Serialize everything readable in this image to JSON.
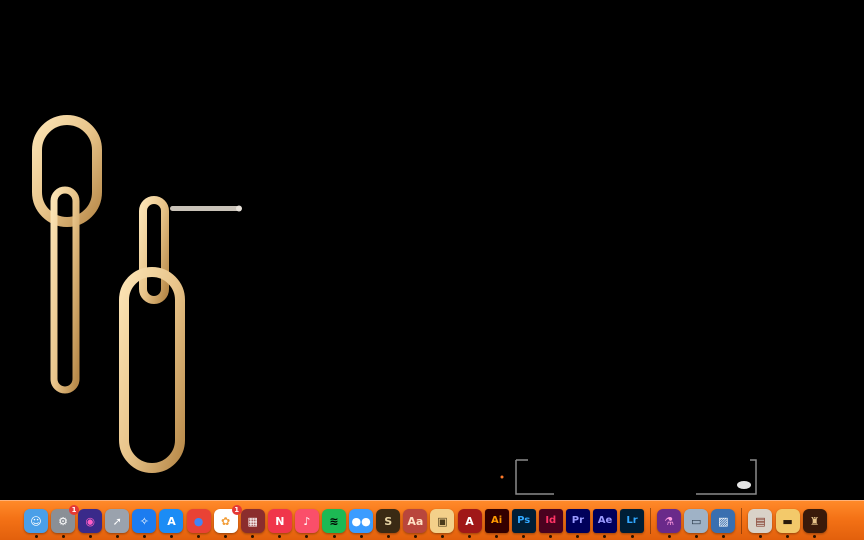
{
  "screen": {
    "background": "#000000"
  },
  "artwork": {
    "subject": "gold-chain-link-earrings",
    "metal_color": "#e8c48a"
  },
  "dock": {
    "background": "#f47216",
    "apps": [
      {
        "name": "Finder",
        "icon": "finder-icon",
        "glyph": "☺",
        "bg": "#4a9fe8",
        "fg": "#ffffff"
      },
      {
        "name": "System Preferences",
        "icon": "gear-icon",
        "glyph": "⚙",
        "bg": "#8a8f96",
        "fg": "#ffffff",
        "badge": "1"
      },
      {
        "name": "Siri",
        "icon": "siri-icon",
        "glyph": "◉",
        "bg": "#3a2a8a",
        "fg": "#ff5ec8"
      },
      {
        "name": "Launchpad",
        "icon": "rocket-icon",
        "glyph": "➚",
        "bg": "#9aa2ad",
        "fg": "#ffffff"
      },
      {
        "name": "Safari",
        "icon": "compass-icon",
        "glyph": "✧",
        "bg": "#1c7cf0",
        "fg": "#ffffff"
      },
      {
        "name": "App Store",
        "icon": "app-store-icon",
        "glyph": "A",
        "bg": "#1b8cf5",
        "fg": "#ffffff"
      },
      {
        "name": "Chrome",
        "icon": "chrome-icon",
        "glyph": "●",
        "bg": "#e94235",
        "fg": "#4285f4"
      },
      {
        "name": "Photos",
        "icon": "photos-icon",
        "glyph": "✿",
        "bg": "#ffffff",
        "fg": "#f29d38",
        "badge": "1"
      },
      {
        "name": "Photo Booth",
        "icon": "photo-booth-icon",
        "glyph": "▦",
        "bg": "#8b2d2d",
        "fg": "#ffffff"
      },
      {
        "name": "News",
        "icon": "news-icon",
        "glyph": "N",
        "bg": "#f0364b",
        "fg": "#ffffff"
      },
      {
        "name": "Music",
        "icon": "music-icon",
        "glyph": "♪",
        "bg": "#fa4f6a",
        "fg": "#ffffff"
      },
      {
        "name": "Spotify",
        "icon": "spotify-icon",
        "glyph": "≋",
        "bg": "#1db954",
        "fg": "#000000"
      },
      {
        "name": "Messages",
        "icon": "chat-icon",
        "glyph": "●●",
        "bg": "#3b9cff",
        "fg": "#ffffff"
      },
      {
        "name": "Scrivener",
        "icon": "scrivener-icon",
        "glyph": "S",
        "bg": "#3a2a14",
        "fg": "#e6d3a3"
      },
      {
        "name": "Dictionary",
        "icon": "dictionary-icon",
        "glyph": "Aa",
        "bg": "#b9463c",
        "fg": "#ffe2c6"
      },
      {
        "name": "Preview",
        "icon": "preview-icon",
        "glyph": "▣",
        "bg": "#f3d08a",
        "fg": "#4a3a1a"
      },
      {
        "name": "Acrobat Reader",
        "icon": "acrobat-icon",
        "glyph": "A",
        "bg": "#a01818",
        "fg": "#ffffff"
      },
      {
        "name": "Illustrator",
        "icon": "illustrator-icon",
        "glyph": "Ai",
        "bg": "#330000",
        "fg": "#ff9a00",
        "adobe": true
      },
      {
        "name": "Photoshop",
        "icon": "photoshop-icon",
        "glyph": "Ps",
        "bg": "#001e36",
        "fg": "#31a8ff",
        "adobe": true
      },
      {
        "name": "InDesign",
        "icon": "indesign-icon",
        "glyph": "Id",
        "bg": "#49021f",
        "fg": "#ff3366",
        "adobe": true
      },
      {
        "name": "Premiere Pro",
        "icon": "premiere-icon",
        "glyph": "Pr",
        "bg": "#00005b",
        "fg": "#9999ff",
        "adobe": true
      },
      {
        "name": "After Effects",
        "icon": "after-effects-icon",
        "glyph": "Ae",
        "bg": "#00005b",
        "fg": "#9999ff",
        "adobe": true
      },
      {
        "name": "Lightroom",
        "icon": "lightroom-icon",
        "glyph": "Lr",
        "bg": "#001e36",
        "fg": "#31a8ff",
        "adobe": true
      }
    ],
    "utilities": [
      {
        "name": "Potion",
        "icon": "potion-icon",
        "glyph": "⚗",
        "bg": "#6a2a8a",
        "fg": "#ff9ae0"
      },
      {
        "name": "Screen Capture",
        "icon": "camera-icon",
        "glyph": "▭",
        "bg": "#9fb2c6",
        "fg": "#2a3a4a"
      },
      {
        "name": "Image Viewer",
        "icon": "image-icon",
        "glyph": "▨",
        "bg": "#3a6fb0",
        "fg": "#ffffff"
      }
    ],
    "stacks": [
      {
        "name": "Downloads Stack",
        "icon": "folder-stack-icon",
        "glyph": "▤",
        "bg": "#d9d2c8",
        "fg": "#7a2a1a"
      },
      {
        "name": "Documents Stack",
        "icon": "folder-stack-icon",
        "glyph": "▬",
        "bg": "#f3c96a",
        "fg": "#2a1a0a"
      },
      {
        "name": "Trash",
        "icon": "trash-icon",
        "glyph": "♜",
        "bg": "#3a1a0a",
        "fg": "#e8c48a"
      }
    ]
  }
}
